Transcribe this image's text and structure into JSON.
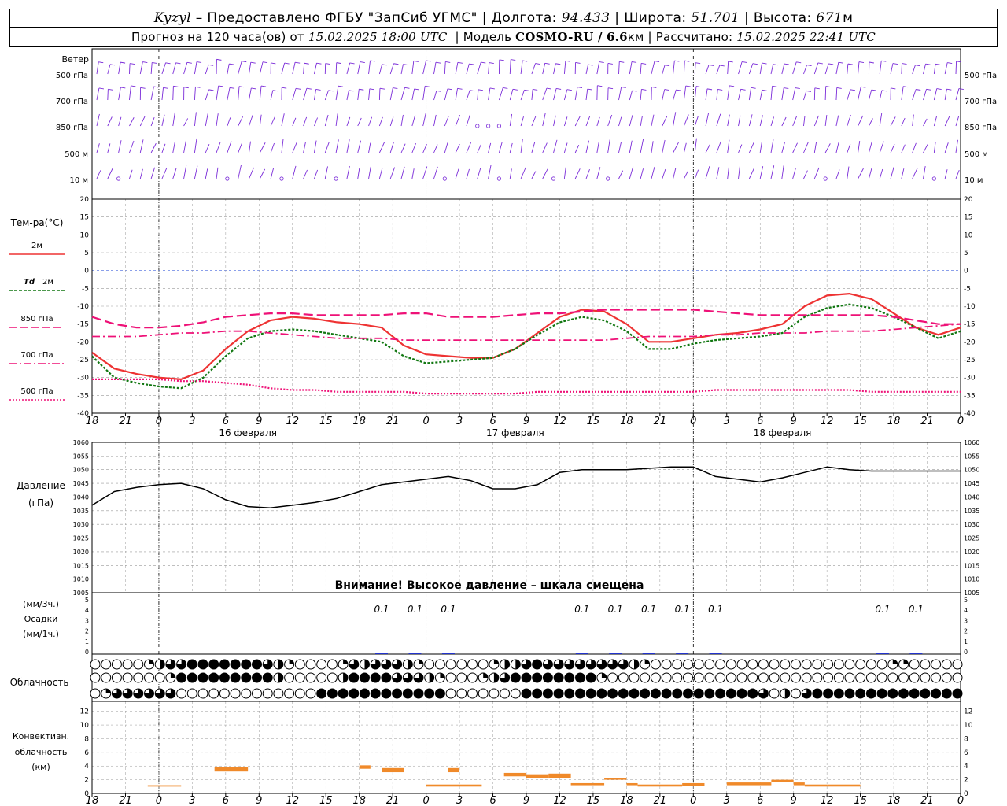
{
  "header": {
    "station": "Kyzyl",
    "provided_by": " – Предоставлено ФГБУ \"ЗапСиб УГМС\" | Долгота: ",
    "lon": "94.433",
    "lat_label": " | Широта: ",
    "lat": "51.701",
    "alt_label": " | Высота: ",
    "alt": "671",
    "alt_unit": "м",
    "forecast_prefix": "Прогноз на 120 часа(ов) от ",
    "forecast_from": "15.02.2025 18:00 UTC",
    "model_prefix": "  | Модель ",
    "model": "COSMO-RU / 6.6",
    "model_unit": "км",
    "computed_prefix": " | Рассчитано: ",
    "computed": "15.02.2025 22:41 UTC"
  },
  "labels": {
    "wind": "Ветер",
    "temp": "Тем-ра(°С)",
    "t2m": "2м",
    "td": "Td",
    "td2m": "2м",
    "p850": "850 гПа",
    "p700": "700 гПа",
    "p500": "500 гПа",
    "pressure1": "Давление",
    "pressure2": "(гПа)",
    "warning": "Внимание! Высокое давление – шкала смещена",
    "precip_u1": "(мм/3ч.)",
    "precip": "Осадки",
    "precip_u2": "(мм/1ч.)",
    "clouds": "Облачность",
    "conv1": "Конвективн.",
    "conv2": "облачность",
    "conv3": "(км)"
  },
  "colors": {
    "t2m": "#ee3333",
    "td2m": "#117711",
    "p850": "#ee1177",
    "p700": "#ee1177",
    "p500": "#ee1177",
    "wind": "#7a2bd8",
    "pressure": "#000000",
    "precip": "#2233cc",
    "conv": "#f08a2a",
    "grid": "#999999",
    "zero": "#4466dd"
  },
  "chart_data": [
    {
      "type": "wind-barbs",
      "levels": [
        "500 гПа",
        "700 гПа",
        "850 гПа",
        "500 м",
        "10 м"
      ],
      "note": "wind barbs per hour at five levels"
    },
    {
      "type": "line",
      "ylabel": "Тем-ра(°С)",
      "ylim": [
        -40,
        20
      ],
      "yticks": [
        20,
        15,
        10,
        5,
        0,
        -5,
        -10,
        -15,
        -20,
        -25,
        -30,
        -35,
        -40
      ],
      "x_hour_ticks": [
        "18",
        "21",
        "0",
        "3",
        "6",
        "9",
        "12",
        "15",
        "18",
        "21",
        "0",
        "3",
        "6",
        "9",
        "12",
        "15",
        "18",
        "21",
        "0",
        "3",
        "6",
        "9",
        "12",
        "15",
        "18",
        "21",
        "0"
      ],
      "dates": [
        {
          "label": "16 февраля",
          "at": 14
        },
        {
          "label": "17 февраля",
          "at": 38
        },
        {
          "label": "18 февраля",
          "at": 62
        }
      ],
      "x_hours": [
        0,
        2,
        4,
        6,
        8,
        10,
        12,
        14,
        16,
        18,
        20,
        22,
        24,
        26,
        28,
        30,
        32,
        34,
        36,
        38,
        40,
        42,
        44,
        46,
        48,
        50,
        52,
        54,
        56,
        58,
        60,
        62,
        64,
        66,
        68,
        70,
        72,
        74,
        76,
        78
      ],
      "series": [
        {
          "name": "2м",
          "values": [
            -23,
            -27.5,
            -29,
            -30,
            -30.5,
            -28,
            -22,
            -17,
            -14,
            -13,
            -13.5,
            -14.5,
            -15,
            -16,
            -21,
            -23.5,
            -24,
            -24.5,
            -24.5,
            -22,
            -17.5,
            -13,
            -11,
            -11.5,
            -15,
            -20,
            -20,
            -19,
            -18,
            -17.5,
            -16.5,
            -15,
            -10,
            -7,
            -6.5,
            -8,
            -12,
            -16,
            -18,
            -16
          ]
        },
        {
          "name": "Td 2м",
          "values": [
            -24,
            -30,
            -31.5,
            -32.5,
            -33,
            -30,
            -24,
            -19,
            -17,
            -16.5,
            -17,
            -18,
            -19,
            -20,
            -24,
            -26,
            -25.5,
            -25,
            -24.5,
            -22,
            -18,
            -14.5,
            -13,
            -14,
            -17,
            -22,
            -22,
            -20.5,
            -19.5,
            -19,
            -18.5,
            -17.5,
            -13,
            -10.5,
            -9.5,
            -10.5,
            -13,
            -16,
            -19,
            -17
          ]
        },
        {
          "name": "850 гПа",
          "values": [
            -13,
            -15,
            -16,
            -16,
            -15.5,
            -14.5,
            -13,
            -12.5,
            -12,
            -12,
            -12.5,
            -12.5,
            -12.5,
            -12.5,
            -12,
            -12,
            -13,
            -13,
            -13,
            -12.5,
            -12,
            -12,
            -11.5,
            -11,
            -11,
            -11,
            -11,
            -11,
            -11.5,
            -12,
            -12.5,
            -12.5,
            -12.5,
            -12.5,
            -12.5,
            -12.5,
            -13,
            -14,
            -15,
            -15
          ]
        },
        {
          "name": "700 гПа",
          "values": [
            -18.5,
            -18.5,
            -18.5,
            -18,
            -17.5,
            -17.5,
            -17,
            -17,
            -17.5,
            -18,
            -18.5,
            -19,
            -19,
            -19,
            -19.5,
            -19.5,
            -19.5,
            -19.5,
            -19.5,
            -19.5,
            -19.5,
            -19.5,
            -19.5,
            -19.5,
            -19,
            -18.5,
            -18.5,
            -18.5,
            -18,
            -18,
            -17.5,
            -17.5,
            -17.5,
            -17,
            -17,
            -17,
            -16.5,
            -16,
            -15.5,
            -15
          ]
        },
        {
          "name": "500 гПа",
          "values": [
            -30.5,
            -30.5,
            -30.5,
            -30.5,
            -31,
            -31,
            -31.5,
            -32,
            -33,
            -33.5,
            -33.5,
            -34,
            -34,
            -34,
            -34,
            -34.5,
            -34.5,
            -34.5,
            -34.5,
            -34.5,
            -34,
            -34,
            -34,
            -34,
            -34,
            -34,
            -34,
            -34,
            -33.5,
            -33.5,
            -33.5,
            -33.5,
            -33.5,
            -33.5,
            -33.5,
            -34,
            -34,
            -34,
            -34,
            -34
          ]
        }
      ]
    },
    {
      "type": "line",
      "ylabel": "Давление (гПа)",
      "ylim": [
        1005,
        1060
      ],
      "yticks": [
        1060,
        1055,
        1050,
        1045,
        1040,
        1035,
        1030,
        1025,
        1020,
        1015,
        1010,
        1005
      ],
      "x_hours": [
        0,
        2,
        4,
        6,
        8,
        10,
        12,
        14,
        16,
        18,
        20,
        22,
        24,
        26,
        28,
        30,
        32,
        34,
        36,
        38,
        40,
        42,
        44,
        46,
        48,
        50,
        52,
        54,
        56,
        58,
        60,
        62,
        64,
        66,
        68,
        70,
        72,
        74,
        76,
        78
      ],
      "series": [
        {
          "name": "Давление",
          "values": [
            1037,
            1042,
            1043.5,
            1044.5,
            1045,
            1043,
            1039,
            1036.5,
            1036,
            1037,
            1038,
            1039.5,
            1042,
            1044.5,
            1045.5,
            1046.5,
            1047.5,
            1046,
            1043,
            1043,
            1044.5,
            1049,
            1050,
            1050,
            1050,
            1050.5,
            1051,
            1051,
            1047.5,
            1046.5,
            1045.5,
            1047,
            1049,
            1051,
            1050,
            1049.5,
            1049.5,
            1049.5,
            1049.5,
            1049.5
          ]
        }
      ]
    },
    {
      "type": "bar",
      "ylabel": "Осадки",
      "ylim": [
        0,
        5
      ],
      "yticks": [
        5,
        4,
        3,
        2,
        1,
        0
      ],
      "labels": [
        {
          "text": "0.1",
          "at": 26
        },
        {
          "text": "0.1",
          "at": 29
        },
        {
          "text": "0.1",
          "at": 32
        },
        {
          "text": "0.1",
          "at": 44
        },
        {
          "text": "0.1",
          "at": 47
        },
        {
          "text": "0.1",
          "at": 50
        },
        {
          "text": "0.1",
          "at": 53
        },
        {
          "text": "0.1",
          "at": 56
        },
        {
          "text": "0.1",
          "at": 71
        },
        {
          "text": "0.1",
          "at": 74
        }
      ]
    },
    {
      "type": "table",
      "name": "Облачность",
      "rows": [
        "000001233444444432100001323332100000012234333333332100000000000000000000001100000",
        "000000014444444442000002444433321000123444444441000000000000000000000000000000000",
        "013333330000000000000444444444444000000044444444444444444444443020344444444444444"
      ]
    },
    {
      "type": "bar",
      "ylabel": "Конвективн. облачность (км)",
      "ylim": [
        0,
        13
      ],
      "yticks": [
        12,
        10,
        8,
        6,
        4,
        2,
        0
      ],
      "bars": [
        {
          "x": [
            5,
            8
          ],
          "y": [
            1,
            1.2
          ]
        },
        {
          "x": [
            11,
            14
          ],
          "y": [
            3.2,
            3.9
          ]
        },
        {
          "x": [
            24,
            25
          ],
          "y": [
            3.6,
            4.1
          ]
        },
        {
          "x": [
            26,
            28
          ],
          "y": [
            3.1,
            3.7
          ]
        },
        {
          "x": [
            30,
            35
          ],
          "y": [
            1,
            1.3
          ]
        },
        {
          "x": [
            32,
            33
          ],
          "y": [
            3.1,
            3.7
          ]
        },
        {
          "x": [
            37,
            39
          ],
          "y": [
            2.5,
            3
          ]
        },
        {
          "x": [
            39,
            41
          ],
          "y": [
            2.3,
            2.8
          ]
        },
        {
          "x": [
            41,
            43
          ],
          "y": [
            2.2,
            2.9
          ]
        },
        {
          "x": [
            43,
            46
          ],
          "y": [
            1.2,
            1.5
          ]
        },
        {
          "x": [
            46,
            48
          ],
          "y": [
            2,
            2.3
          ]
        },
        {
          "x": [
            48,
            49
          ],
          "y": [
            1.2,
            1.5
          ]
        },
        {
          "x": [
            49,
            53
          ],
          "y": [
            1,
            1.3
          ]
        },
        {
          "x": [
            53,
            55
          ],
          "y": [
            1.1,
            1.5
          ]
        },
        {
          "x": [
            57,
            61
          ],
          "y": [
            1.2,
            1.6
          ]
        },
        {
          "x": [
            61,
            63
          ],
          "y": [
            1.7,
            2
          ]
        },
        {
          "x": [
            63,
            64
          ],
          "y": [
            1.2,
            1.6
          ]
        },
        {
          "x": [
            64,
            66
          ],
          "y": [
            1,
            1.3
          ]
        },
        {
          "x": [
            66,
            69
          ],
          "y": [
            1,
            1.3
          ]
        }
      ]
    }
  ]
}
